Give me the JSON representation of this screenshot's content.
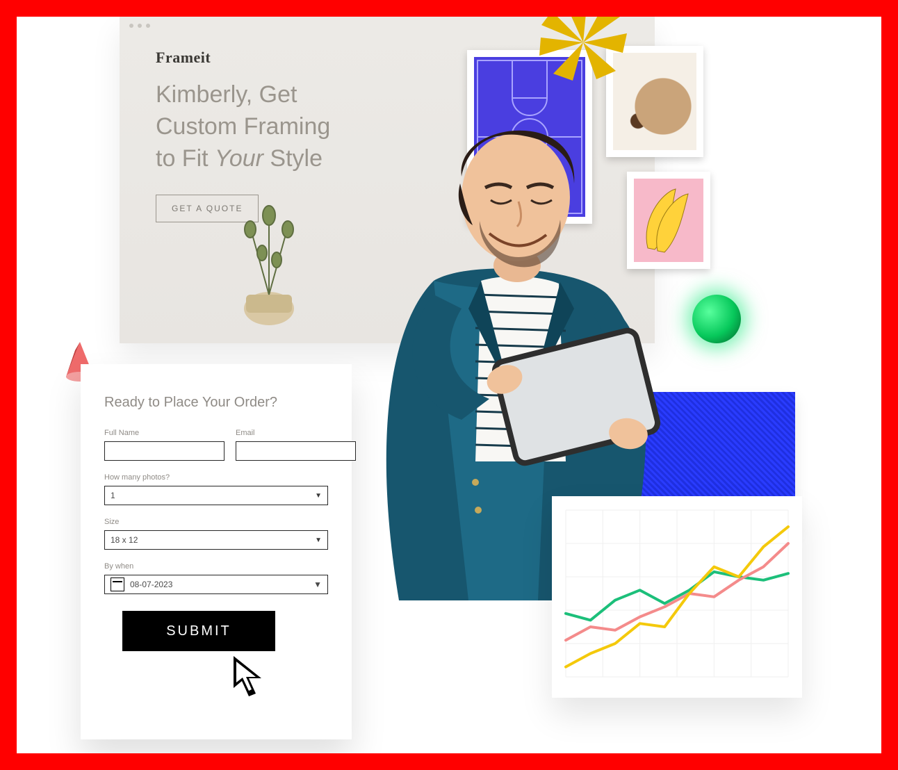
{
  "landing": {
    "brand": "Frameit",
    "hero_line1": "Kimberly, Get",
    "hero_line2": "Custom Framing",
    "hero_line3_pre": "to Fit ",
    "hero_line3_em": "Your",
    "hero_line3_post": " Style",
    "cta_label": "GET A QUOTE"
  },
  "order": {
    "heading": "Ready to Place Your Order?",
    "full_name_label": "Full Name",
    "email_label": "Email",
    "photos_label": "How many photos?",
    "photos_value": "1",
    "size_label": "Size",
    "size_value": "18 x 12",
    "bywhen_label": "By when",
    "bywhen_value": "08-07-2023",
    "submit_label": "SUBMIT"
  },
  "chart_data": {
    "type": "line",
    "x": [
      0,
      1,
      2,
      3,
      4,
      5,
      6,
      7,
      8,
      9
    ],
    "series": [
      {
        "name": "green",
        "color": "#1cbf7a",
        "values": [
          38,
          34,
          46,
          52,
          44,
          52,
          63,
          60,
          58,
          62
        ]
      },
      {
        "name": "pink",
        "color": "#f48b8b",
        "values": [
          22,
          30,
          28,
          36,
          42,
          50,
          48,
          58,
          66,
          80
        ]
      },
      {
        "name": "yellow",
        "color": "#f4c90b",
        "values": [
          6,
          14,
          20,
          32,
          30,
          50,
          66,
          60,
          78,
          90
        ]
      }
    ],
    "xlim": [
      0,
      9
    ],
    "ylim": [
      0,
      100
    ]
  },
  "colors": {
    "accent_blue": "#2a3cff",
    "accent_green": "#07c85b",
    "accent_gold": "#e3b400"
  }
}
